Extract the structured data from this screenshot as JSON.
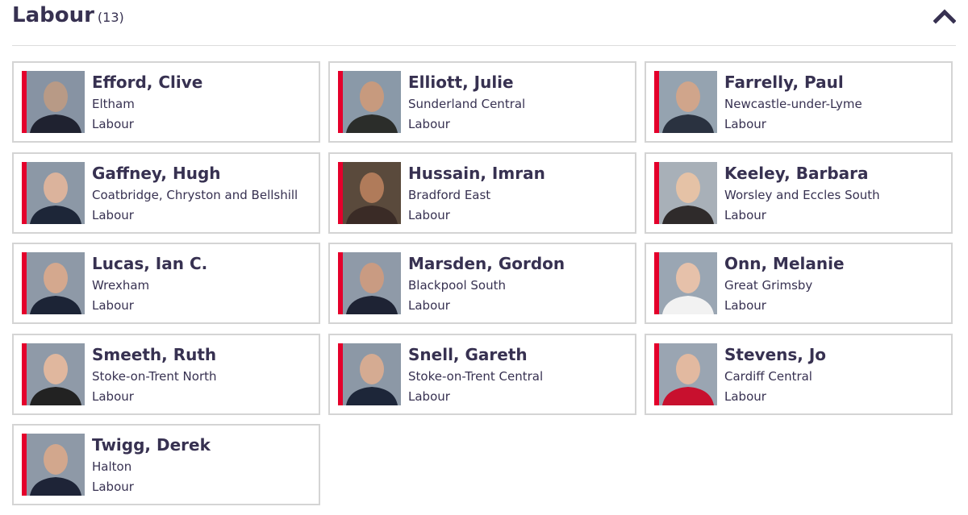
{
  "section": {
    "title": "Labour",
    "count": "(13)",
    "collapse_icon": "chevron-up-icon"
  },
  "members": [
    {
      "name": "Efford, Clive",
      "constituency": "Eltham",
      "party": "Labour"
    },
    {
      "name": "Elliott, Julie",
      "constituency": "Sunderland Central",
      "party": "Labour"
    },
    {
      "name": "Farrelly, Paul",
      "constituency": "Newcastle-under-Lyme",
      "party": "Labour"
    },
    {
      "name": "Gaffney, Hugh",
      "constituency": "Coatbridge, Chryston and Bellshill",
      "party": "Labour"
    },
    {
      "name": "Hussain, Imran",
      "constituency": "Bradford East",
      "party": "Labour"
    },
    {
      "name": "Keeley, Barbara",
      "constituency": "Worsley and Eccles South",
      "party": "Labour"
    },
    {
      "name": "Lucas, Ian C.",
      "constituency": "Wrexham",
      "party": "Labour"
    },
    {
      "name": "Marsden, Gordon",
      "constituency": "Blackpool South",
      "party": "Labour"
    },
    {
      "name": "Onn, Melanie",
      "constituency": "Great Grimsby",
      "party": "Labour"
    },
    {
      "name": "Smeeth, Ruth",
      "constituency": "Stoke-on-Trent North",
      "party": "Labour"
    },
    {
      "name": "Snell, Gareth",
      "constituency": "Stoke-on-Trent Central",
      "party": "Labour"
    },
    {
      "name": "Stevens, Jo",
      "constituency": "Cardiff Central",
      "party": "Labour"
    },
    {
      "name": "Twigg, Derek",
      "constituency": "Halton",
      "party": "Labour"
    }
  ],
  "colors": {
    "party_accent": "#e4002b",
    "text": "#373151",
    "card_border": "#d4d4d4"
  }
}
